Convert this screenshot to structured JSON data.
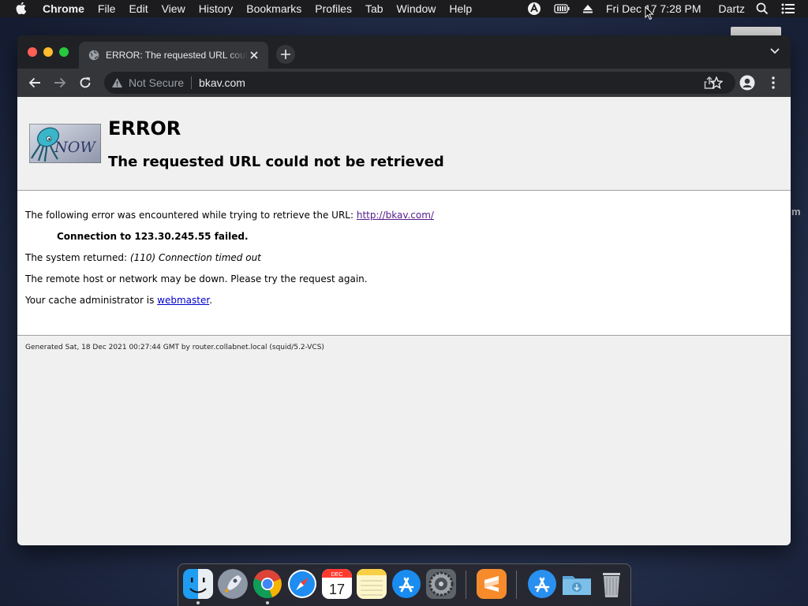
{
  "menubar": {
    "app": "Chrome",
    "items": [
      "File",
      "Edit",
      "View",
      "History",
      "Bookmarks",
      "Profiles",
      "Tab",
      "Window",
      "Help"
    ],
    "clock": "Fri Dec 17  7:28 PM",
    "user": "Dartz"
  },
  "desktop": {
    "side_label": "m"
  },
  "browser": {
    "tab_title": "ERROR: The requested URL could not be retrieved",
    "security_label": "Not Secure",
    "url": "bkav.com"
  },
  "page": {
    "logo_text": "NOW",
    "heading": "ERROR",
    "subheading": "The requested URL could not be retrieved",
    "line1_text": "The following error was encountered while trying to retrieve the URL: ",
    "line1_link": "http://bkav.com/",
    "line2": "Connection to 123.30.245.55 failed.",
    "line3_text": "The system returned: ",
    "line3_em": "(110) Connection timed out",
    "line4": "The remote host or network may be down. Please try the request again.",
    "line5_text": "Your cache administrator is ",
    "line5_link": "webmaster",
    "line5_end": ".",
    "footer": "Generated Sat, 18 Dec 2021 00:27:44 GMT by router.collabnet.local (squid/5.2-VCS)"
  },
  "dock": {
    "calendar_month": "DEC",
    "calendar_day": "17",
    "apps": [
      "finder",
      "launchpad",
      "chrome",
      "safari",
      "calendar",
      "notes",
      "app-store",
      "system-preferences",
      "sublime",
      "app-store-folder",
      "downloads-folder",
      "trash"
    ]
  },
  "colors": {
    "accent_link": "#0000cc",
    "visited_link": "#551a8b",
    "chrome_dark": "#202124",
    "toolbar": "#35363a"
  }
}
